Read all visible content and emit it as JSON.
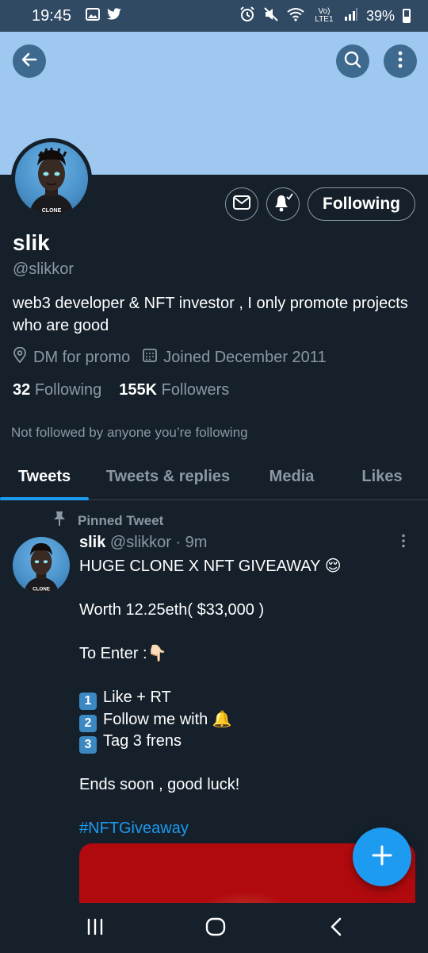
{
  "status_bar": {
    "time": "19:45",
    "network": "Vo) LTE1",
    "battery": "39%"
  },
  "profile": {
    "name": "slik",
    "handle": "@slikkor",
    "bio": "web3 developer & NFT investor , I only promote projects who are good",
    "location": "DM for promo",
    "joined": "Joined December 2011",
    "following_count": "32",
    "following_label": "Following",
    "followers_count": "155K",
    "followers_label": "Followers",
    "not_followed_note": "Not followed by anyone you’re following",
    "follow_button": "Following",
    "avatar_shirt_text": "CLONE"
  },
  "tabs": [
    "Tweets",
    "Tweets & replies",
    "Media",
    "Likes"
  ],
  "tweet": {
    "pinned_label": "Pinned Tweet",
    "author_name": "slik",
    "author_handle": "@slikkor",
    "time": "· 9m",
    "title": "HUGE CLONE X NFT GIVEAWAY",
    "title_emoji": "😌",
    "worth": "Worth 12.25eth( $33,000 )",
    "to_enter": "To Enter :",
    "to_enter_emoji": "👇🏻",
    "step1_key": "1",
    "step1": "Like + RT",
    "step2_key": "2",
    "step2": "Follow me with",
    "step2_emoji": "🔔",
    "step3_key": "3",
    "step3": "Tag 3 frens",
    "ends": "Ends soon , good luck!",
    "hashtag": "#NFTGiveaway"
  },
  "colors": {
    "background": "#15202b",
    "banner": "#9ec8f0",
    "accent": "#1d9bf0",
    "muted_text": "#8b98a5",
    "divider": "#38444d"
  },
  "icons": [
    "back-arrow-icon",
    "search-icon",
    "more-vertical-icon",
    "mail-icon",
    "bell-check-icon",
    "location-pin-icon",
    "calendar-icon",
    "pin-icon",
    "plus-icon",
    "recent-apps-icon",
    "home-icon",
    "nav-back-icon"
  ]
}
